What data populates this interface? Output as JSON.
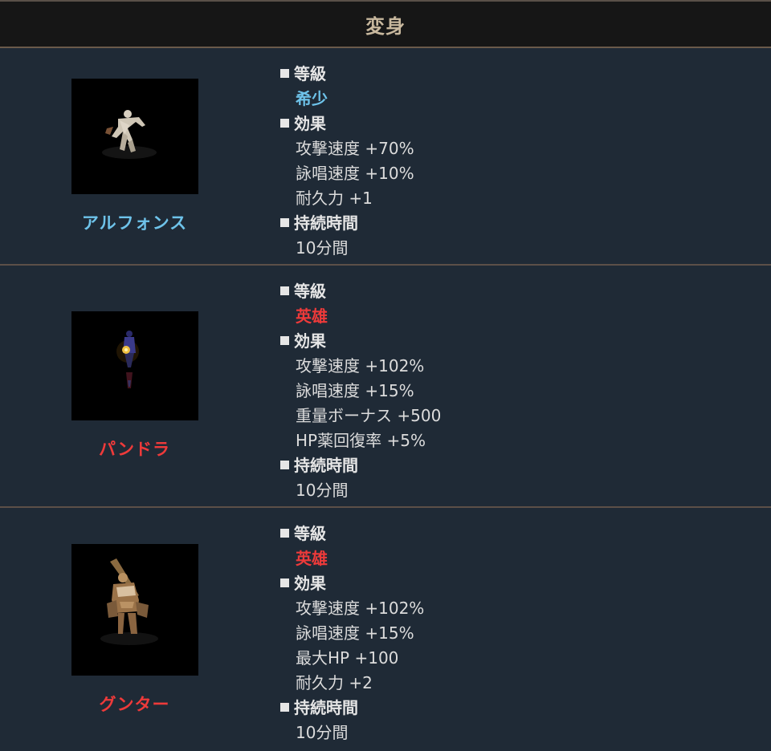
{
  "header": {
    "title": "変身"
  },
  "entries": [
    {
      "name": "アルフォンス",
      "grade_heading": "■等級",
      "grade": "希少",
      "effects_heading": "■効果",
      "effects": [
        "攻撃速度 +70%",
        "詠唱速度 +10%",
        "耐久力 +1"
      ],
      "duration_heading": "■持続時間",
      "duration": "10分間",
      "colors": {
        "grade": "#6ec3ea"
      }
    },
    {
      "name": "パンドラ",
      "grade_heading": "■等級",
      "grade": "英雄",
      "effects_heading": "■効果",
      "effects": [
        "攻撃速度 +102%",
        "詠唱速度 +15%",
        "重量ボーナス +500",
        "HP薬回復率 +5%"
      ],
      "duration_heading": "■持続時間",
      "duration": "10分間",
      "colors": {
        "grade": "#ee3a3a"
      }
    },
    {
      "name": "グンター",
      "grade_heading": "■等級",
      "grade": "英雄",
      "effects_heading": "■効果",
      "effects": [
        "攻撃速度 +102%",
        "詠唱速度 +15%",
        "最大HP +100",
        "耐久力 +2"
      ],
      "duration_heading": "■持続時間",
      "duration": "10分間",
      "colors": {
        "grade": "#ee3a3a"
      }
    }
  ]
}
